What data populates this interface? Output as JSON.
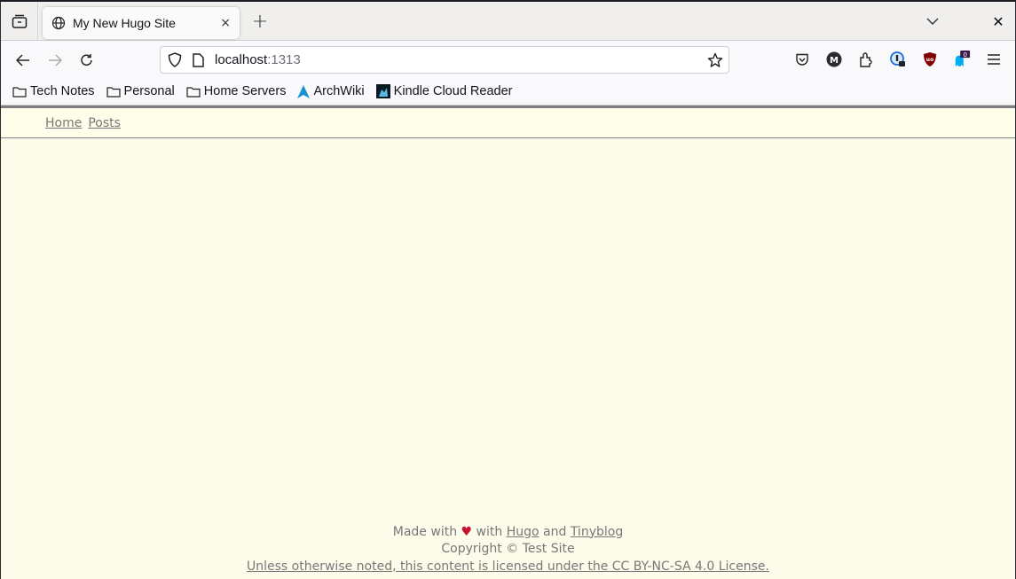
{
  "browser": {
    "tab": {
      "title": "My New Hugo Site",
      "icon": "globe-icon",
      "close_glyph": "×"
    },
    "new_tab_glyph": "+",
    "window_close_glyph": "✕",
    "url": {
      "host": "localhost",
      "port": ":1313"
    },
    "bookmarks": [
      {
        "label": "Tech Notes",
        "icon": "folder-icon"
      },
      {
        "label": "Personal",
        "icon": "folder-icon"
      },
      {
        "label": "Home Servers",
        "icon": "folder-icon"
      },
      {
        "label": "ArchWiki",
        "icon": "arch-logo-icon"
      },
      {
        "label": "Kindle Cloud Reader",
        "icon": "kindle-icon"
      }
    ],
    "extensions": [
      {
        "name": "pocket-icon"
      },
      {
        "name": "m-extension-icon",
        "letter": "M"
      },
      {
        "name": "extensions-puzzle-icon"
      },
      {
        "name": "onepassword-icon"
      },
      {
        "name": "ublock-origin-icon",
        "letter": "uo"
      },
      {
        "name": "ghostery-icon",
        "badge": "0"
      },
      {
        "name": "app-menu-icon"
      }
    ]
  },
  "site": {
    "nav": [
      "Home",
      "Posts"
    ],
    "footer": {
      "made_with": "Made with",
      "heart": "♥",
      "with": "with",
      "hugo": "Hugo",
      "and": "and",
      "tinyblog": "Tinyblog",
      "copyright": "Copyright © Test Site",
      "license": "Unless otherwise noted, this content is licensed under the CC BY-NC-SA 4.0 License."
    },
    "colors": {
      "background": "#fdfbea",
      "header_bg": "#fffeea",
      "link": "#777777",
      "heart": "#c4122f"
    }
  }
}
